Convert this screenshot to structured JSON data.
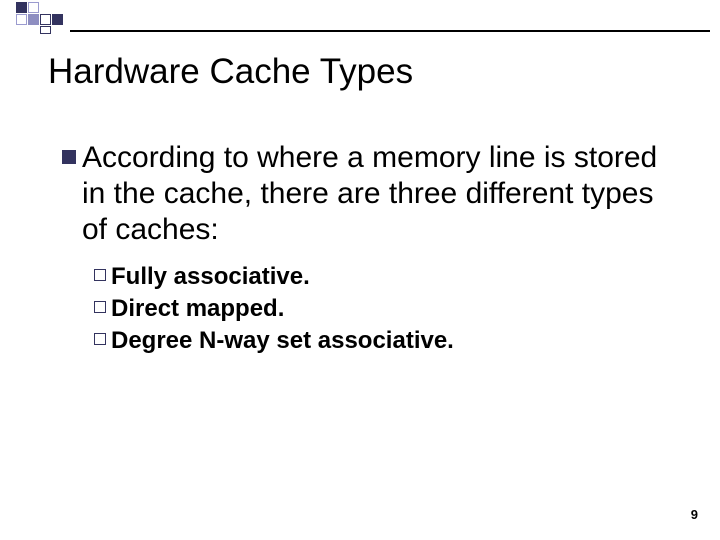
{
  "title": "Hardware Cache Types",
  "body": {
    "main": "According to where a memory line is stored in the cache, there are three different types of caches:",
    "sub1": "Fully associative.",
    "sub2": "Direct mapped.",
    "sub3": "Degree N-way set associative."
  },
  "page_number": "9"
}
